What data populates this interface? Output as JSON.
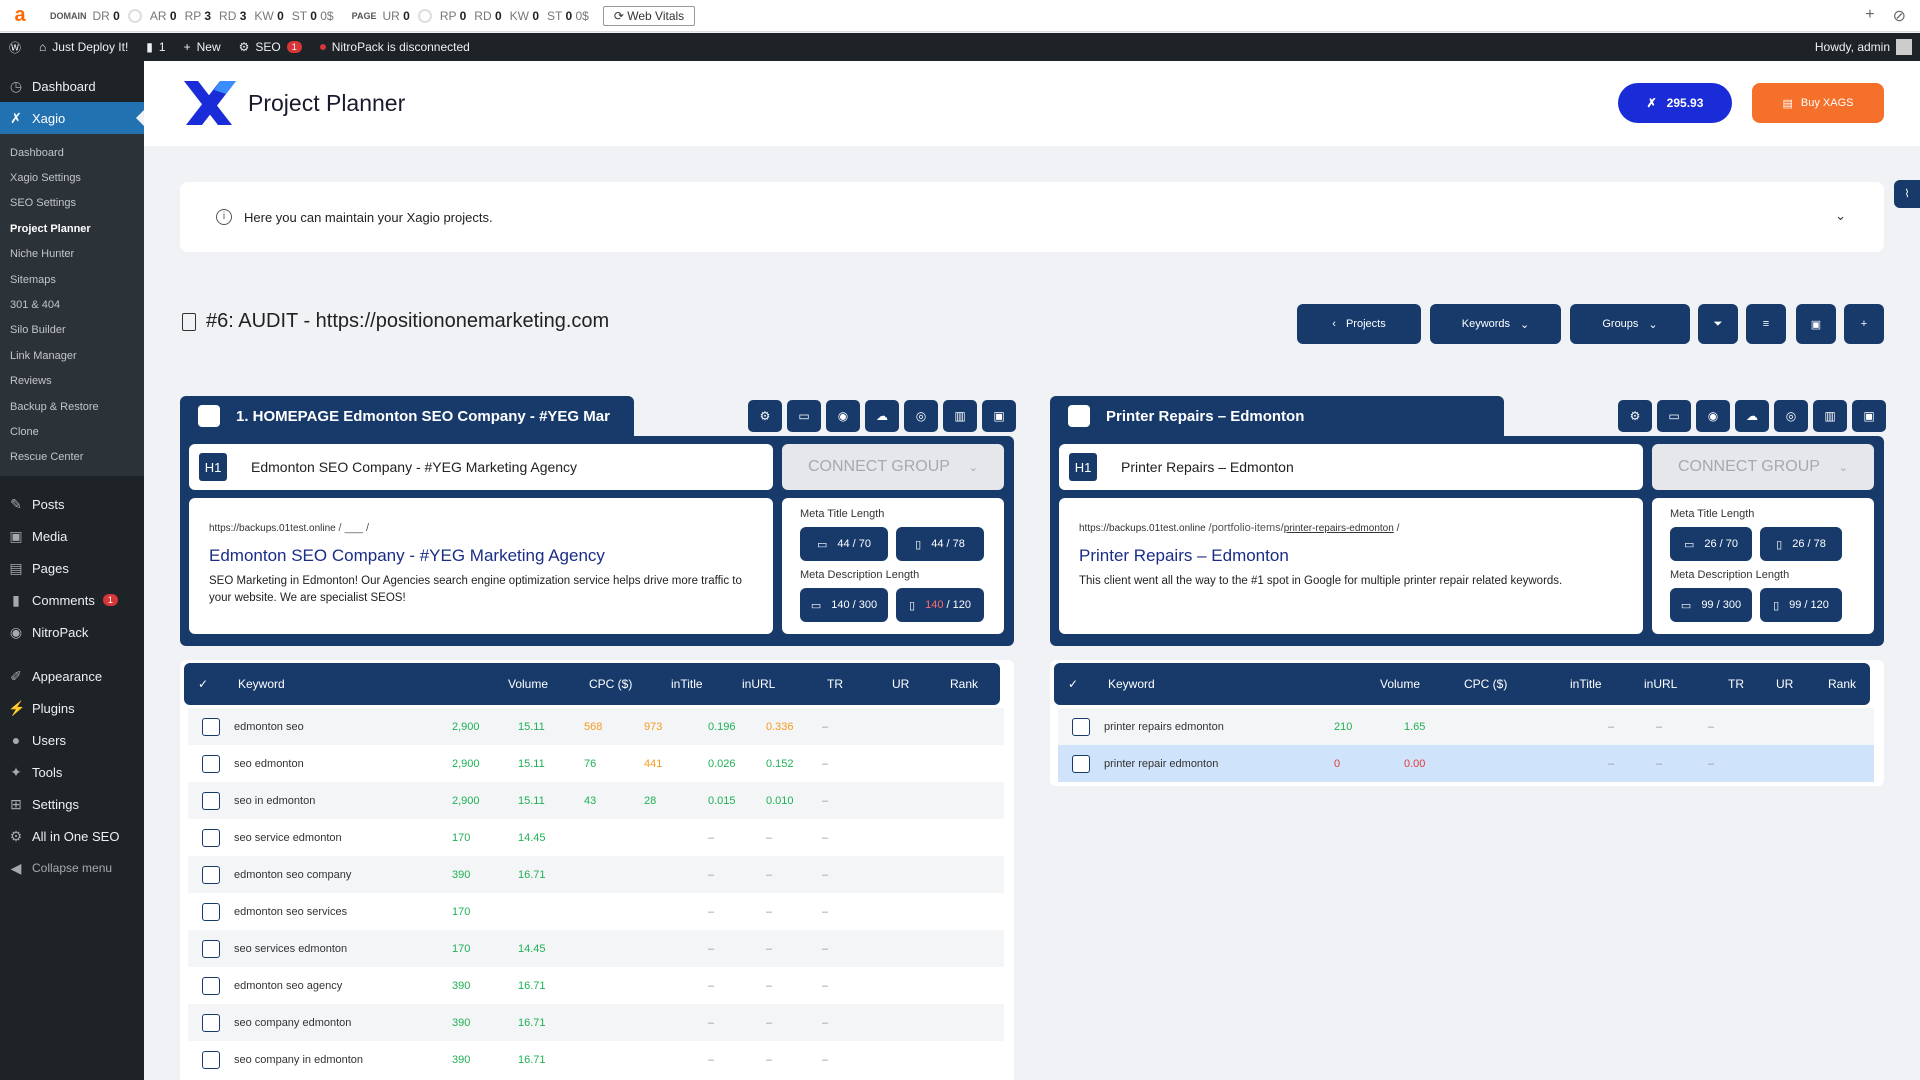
{
  "seobar": {
    "domain_label": "DOMAIN",
    "domain_metrics": [
      {
        "k": "DR",
        "v": "0"
      },
      {
        "k": "AR",
        "v": "0"
      },
      {
        "k": "RP",
        "v": "3"
      },
      {
        "k": "RD",
        "v": "3"
      },
      {
        "k": "KW",
        "v": "0"
      },
      {
        "k": "ST",
        "v": "0"
      }
    ],
    "domain_st_suffix": "0$",
    "page_label": "PAGE",
    "page_metrics": [
      {
        "k": "UR",
        "v": "0"
      },
      {
        "k": "RP",
        "v": "0"
      },
      {
        "k": "RD",
        "v": "0"
      },
      {
        "k": "KW",
        "v": "0"
      },
      {
        "k": "ST",
        "v": "0"
      }
    ],
    "page_st_suffix": "0$",
    "web_vitals": "Web Vitals"
  },
  "adminbar": {
    "site": "Just Deploy It!",
    "comments": "1",
    "new": "New",
    "seo": "SEO",
    "seo_badge": "1",
    "nitro": "NitroPack is disconnected",
    "howdy": "Howdy, admin"
  },
  "sidebar": {
    "dashboard": "Dashboard",
    "xagio": "Xagio",
    "sub": [
      "Dashboard",
      "Xagio Settings",
      "SEO Settings",
      "Project Planner",
      "Niche Hunter",
      "Sitemaps",
      "301 & 404",
      "Silo Builder",
      "Link Manager",
      "Reviews",
      "Backup & Restore",
      "Clone",
      "Rescue Center"
    ],
    "posts": "Posts",
    "media": "Media",
    "pages": "Pages",
    "comments": "Comments",
    "comments_badge": "1",
    "nitropack": "NitroPack",
    "appearance": "Appearance",
    "plugins": "Plugins",
    "users": "Users",
    "tools": "Tools",
    "settings": "Settings",
    "aioseo": "All in One SEO",
    "collapse": "Collapse menu"
  },
  "header": {
    "title": "Project Planner",
    "xags": "295.93",
    "buy": "Buy XAGS"
  },
  "info": {
    "text": "Here you can maintain your Xagio projects."
  },
  "project": {
    "title": "#6: AUDIT - https://positiononemarketing.com",
    "btn_projects": "Projects",
    "btn_keywords": "Keywords",
    "btn_groups": "Groups"
  },
  "groups": [
    {
      "name": "1. HOMEPAGE Edmonton SEO Company - #YEG Mar",
      "h1": "Edmonton SEO Company - #YEG Marketing Agency",
      "h1_badge": "H1",
      "connect": "CONNECT GROUP",
      "url_host": "https://backups.01test.online",
      "url_path": "/ ___ /",
      "url_slug": "",
      "preview_title": "Edmonton SEO Company - #YEG Marketing Agency",
      "preview_desc": "SEO Marketing in Edmonton! Our Agencies search engine optimization service helps drive more traffic to your website. We are specialist SEOS!",
      "meta_title_label": "Meta Title Length",
      "meta_title_a": "44 / 70",
      "meta_title_b": "44 / 78",
      "meta_desc_label": "Meta Description Length",
      "meta_desc_a": "140 / 300",
      "meta_desc_b_num": "140",
      "meta_desc_b_den": " / 120",
      "columns": [
        "Keyword",
        "Volume",
        "CPC ($)",
        "inTitle",
        "inURL",
        "TR",
        "UR",
        "Rank"
      ],
      "rows": [
        {
          "kw": "edmonton seo",
          "vol": "2,900",
          "cpc": "15.11",
          "intitle": "568",
          "inurl": "973",
          "tr": "0.196",
          "ur": "0.336",
          "rank": "–"
        },
        {
          "kw": "seo edmonton",
          "vol": "2,900",
          "cpc": "15.11",
          "intitle": "76",
          "inurl": "441",
          "tr": "0.026",
          "ur": "0.152",
          "rank": "–"
        },
        {
          "kw": "seo in edmonton",
          "vol": "2,900",
          "cpc": "15.11",
          "intitle": "43",
          "inurl": "28",
          "tr": "0.015",
          "ur": "0.010",
          "rank": "–"
        },
        {
          "kw": "seo service edmonton",
          "vol": "170",
          "cpc": "14.45",
          "intitle": "",
          "inurl": "",
          "tr": "–",
          "ur": "–",
          "rank": "–"
        },
        {
          "kw": "edmonton seo company",
          "vol": "390",
          "cpc": "16.71",
          "intitle": "",
          "inurl": "",
          "tr": "–",
          "ur": "–",
          "rank": "–"
        },
        {
          "kw": "edmonton seo services",
          "vol": "170",
          "cpc": "",
          "intitle": "",
          "inurl": "",
          "tr": "–",
          "ur": "–",
          "rank": "–"
        },
        {
          "kw": "seo services edmonton",
          "vol": "170",
          "cpc": "14.45",
          "intitle": "",
          "inurl": "",
          "tr": "–",
          "ur": "–",
          "rank": "–"
        },
        {
          "kw": "edmonton seo agency",
          "vol": "390",
          "cpc": "16.71",
          "intitle": "",
          "inurl": "",
          "tr": "–",
          "ur": "–",
          "rank": "–"
        },
        {
          "kw": "seo company edmonton",
          "vol": "390",
          "cpc": "16.71",
          "intitle": "",
          "inurl": "",
          "tr": "–",
          "ur": "–",
          "rank": "–"
        },
        {
          "kw": "seo company in edmonton",
          "vol": "390",
          "cpc": "16.71",
          "intitle": "",
          "inurl": "",
          "tr": "–",
          "ur": "–",
          "rank": "–"
        }
      ]
    },
    {
      "name": "Printer Repairs – Edmonton",
      "h1": "Printer Repairs – Edmonton",
      "h1_badge": "H1",
      "connect": "CONNECT GROUP",
      "url_host": "https://backups.01test.online",
      "url_path": "/portfolio-items/",
      "url_slug": "printer-repairs-edmonton",
      "url_end": " /",
      "preview_title": "Printer Repairs – Edmonton",
      "preview_desc": "This client went all the way to the #1 spot in Google for multiple printer repair related keywords.",
      "meta_title_label": "Meta Title Length",
      "meta_title_a": "26 / 70",
      "meta_title_b": "26 / 78",
      "meta_desc_label": "Meta Description Length",
      "meta_desc_a": "99 / 300",
      "meta_desc_b": "99 / 120",
      "columns": [
        "Keyword",
        "Volume",
        "CPC ($)",
        "inTitle",
        "inURL",
        "TR",
        "UR",
        "Rank"
      ],
      "rows": [
        {
          "kw": "printer repairs edmonton",
          "vol": "210",
          "cpc": "1.65",
          "tr": "–",
          "ur": "–",
          "rank": "–"
        },
        {
          "kw": "printer repair edmonton",
          "vol": "0",
          "cpc": "0.00",
          "tr": "–",
          "ur": "–",
          "rank": "–"
        }
      ]
    }
  ],
  "colors": {
    "navy": "#173a6b",
    "blue": "#1a2bd8",
    "orange": "#f5702a",
    "wp_dark": "#1d2327",
    "wp_blue": "#2271b1"
  }
}
